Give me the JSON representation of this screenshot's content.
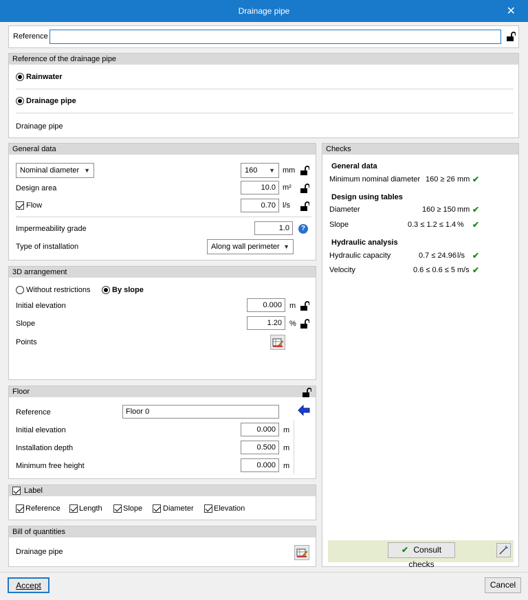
{
  "window": {
    "title": "Drainage pipe",
    "close": "✕"
  },
  "top": {
    "reference_label": "Reference",
    "reference_value": ""
  },
  "ref_panel": {
    "title": "Reference of the drainage pipe",
    "opt1": "Rainwater",
    "opt2": "Drainage pipe",
    "value": "Drainage pipe"
  },
  "general": {
    "title": "General data",
    "diameter_select": "Nominal diameter",
    "diameter_value": "160",
    "diameter_unit": "mm",
    "area_label": "Design area",
    "area_value": "10.0",
    "area_unit": "m²",
    "flow_label": "Flow",
    "flow_value": "0.70",
    "flow_unit": "l/s",
    "imp_label": "Impermeability grade",
    "imp_value": "1.0",
    "imp_help": "?",
    "install_label": "Type of installation",
    "install_value": "Along wall perimeter"
  },
  "arr3d": {
    "title": "3D arrangement",
    "opt1": "Without restrictions",
    "opt2": "By slope",
    "elev_label": "Initial elevation",
    "elev_value": "0.000",
    "elev_unit": "m",
    "slope_label": "Slope",
    "slope_value": "1.20",
    "slope_unit": "%",
    "points_label": "Points"
  },
  "floor": {
    "title": "Floor",
    "ref_label": "Reference",
    "ref_value": "Floor 0",
    "elev_label": "Initial elevation",
    "elev_value": "0.000",
    "depth_label": "Installation depth",
    "depth_value": "0.500",
    "height_label": "Minimum free height",
    "height_value": "0.000",
    "unit": "m"
  },
  "label": {
    "title": "Label",
    "items": [
      "Reference",
      "Length",
      "Slope",
      "Diameter",
      "Elevation"
    ]
  },
  "boq": {
    "title": "Bill of quantities",
    "item": "Drainage pipe"
  },
  "checks": {
    "title": "Checks",
    "s1": "General data",
    "r1_label": "Minimum nominal diameter",
    "r1_value": "160 ≥ 26",
    "r1_unit": "mm",
    "s2": "Design using tables",
    "r2_label": "Diameter",
    "r2_value": "160 ≥ 150",
    "r2_unit": "mm",
    "r3_label": "Slope",
    "r3_value": "0.3 ≤ 1.2 ≤ 1.4",
    "r3_unit": "%",
    "s3": "Hydraulic analysis",
    "r4_label": "Hydraulic capacity",
    "r4_value": "0.7 ≤ 24.96",
    "r4_unit": "l/s",
    "r5_label": "Velocity",
    "r5_value": "0.6 ≤ 0.6 ≤ 5",
    "r5_unit": "m/s",
    "check_mark": "✔",
    "consult": "Consult checks"
  },
  "footer": {
    "accept": "Accept",
    "cancel": "Cancel"
  }
}
